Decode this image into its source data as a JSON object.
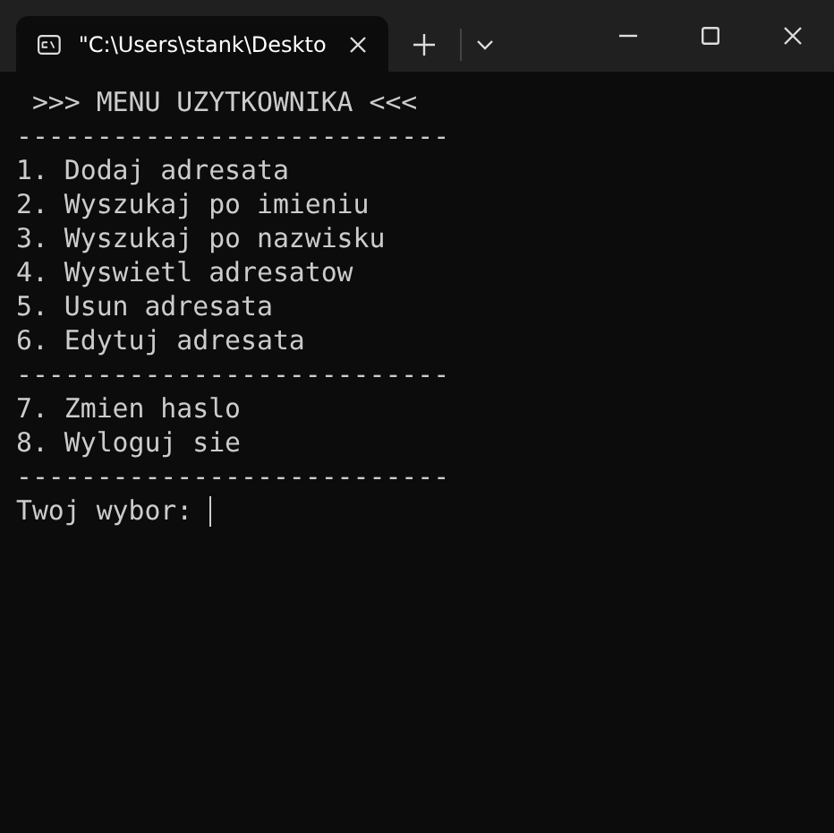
{
  "tab": {
    "title": "\"C:\\Users\\stank\\Deskto",
    "selected": true
  },
  "terminal": {
    "lines": [
      {
        "kind": "text",
        "text": " >>> MENU UZYTKOWNIKA <<<"
      },
      {
        "kind": "text",
        "text": "---------------------------"
      },
      {
        "kind": "text",
        "text": "1. Dodaj adresata"
      },
      {
        "kind": "text",
        "text": "2. Wyszukaj po imieniu"
      },
      {
        "kind": "text",
        "text": "3. Wyszukaj po nazwisku"
      },
      {
        "kind": "text",
        "text": "4. Wyswietl adresatow"
      },
      {
        "kind": "text",
        "text": "5. Usun adresata"
      },
      {
        "kind": "text",
        "text": "6. Edytuj adresata"
      },
      {
        "kind": "text",
        "text": "---------------------------"
      },
      {
        "kind": "text",
        "text": "7. Zmien haslo"
      },
      {
        "kind": "text",
        "text": "8. Wyloguj sie"
      },
      {
        "kind": "text",
        "text": "---------------------------"
      },
      {
        "kind": "prompt",
        "text": "Twoj wybor:"
      }
    ]
  }
}
